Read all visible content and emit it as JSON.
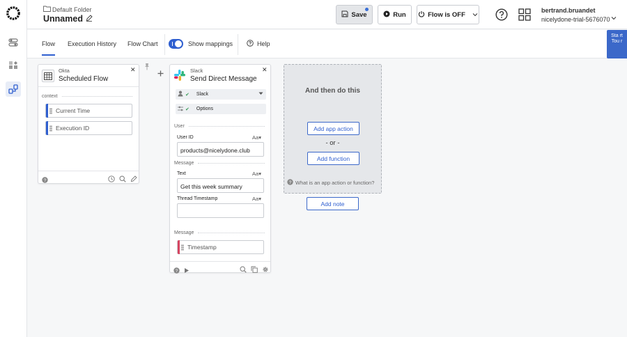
{
  "header": {
    "folder": "Default Folder",
    "title": "Unnamed",
    "save_label": "Save",
    "run_label": "Run",
    "flow_status_label": "Flow is OFF",
    "user_name": "bertrand.bruandet",
    "user_org": "nicelydone-trial-5676070"
  },
  "tabs": {
    "flow": "Flow",
    "execution_history": "Execution History",
    "flow_chart": "Flow Chart",
    "show_mappings": "Show mappings",
    "help": "Help"
  },
  "tour_label": "Sta rt Tou r",
  "okta_card": {
    "app": "Okta",
    "title": "Scheduled Flow",
    "section": "context",
    "outputs": [
      "Current Time",
      "Execution ID"
    ]
  },
  "slack_card": {
    "app": "Slack",
    "title": "Send Direct Message",
    "connection": "Slack",
    "options_label": "Options",
    "section_user": "User",
    "user_id_label": "User ID",
    "user_id_value": "products@nicelydone.club",
    "section_message": "Message",
    "text_label": "Text",
    "text_value": "Get this week summary",
    "thread_label": "Thread Timestamp",
    "thread_value": "",
    "type_glyph": "Aa",
    "output_section": "Message",
    "output": "Timestamp"
  },
  "placeholder": {
    "heading": "And then do this",
    "add_app_action": "Add app action",
    "or": "- or -",
    "add_function": "Add function",
    "what_is": "What is an app action or function?"
  },
  "add_note": "Add note",
  "colors": {
    "accent": "#2f5fd0",
    "danger_bar": "#d64460"
  }
}
